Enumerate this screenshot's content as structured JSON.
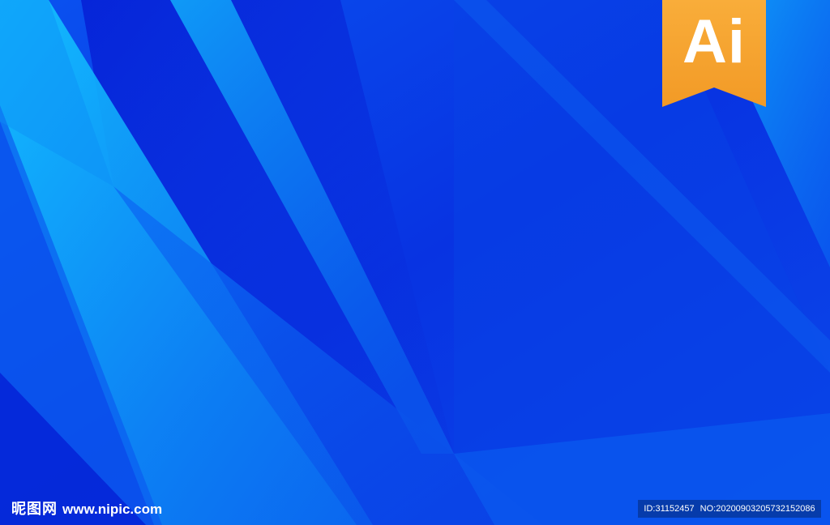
{
  "badge": {
    "label": "Ai",
    "background": "#f7a432",
    "text_color": "#ffffff"
  },
  "watermark": {
    "logo_cn": "昵图网",
    "url": "www.nipic.com",
    "id_text": "ID:31152457",
    "no_text": "NO:20200903205732152086"
  },
  "palette": {
    "base": "#0a3fe0",
    "deep": "#0625d8",
    "mid": "#0b5cf0",
    "light": "#0e8ef6",
    "bright": "#12b4fb"
  }
}
